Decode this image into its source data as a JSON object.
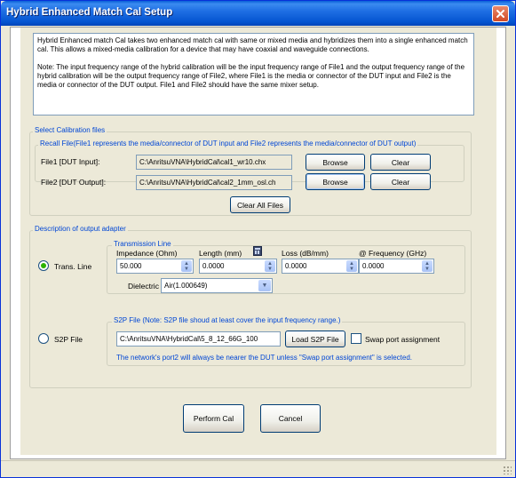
{
  "window": {
    "title": "Hybrid Enhanced Match Cal Setup"
  },
  "description": {
    "para1": "Hybrid Enhanced match Cal takes two enhanced match cal with same or mixed media and hybridizes them into a single enhanced match cal.  This allows a mixed-media calibration for a device that may have coaxial and waveguide connections.",
    "para2": "Note: The input frequency range of the hybrid calibration will be the input frequency range of File1 and the output frequency range of the hybrid calibration will be the output frequency range of File2, where File1 is the media or connector of the DUT input and File2 is the media or connector of the DUT output. File1 and File2 should have the same mixer setup."
  },
  "calfiles": {
    "group_label": "Select Calibration files",
    "recall_label": "Recall File(File1 represents the media/connector of DUT input and File2 represents the media/connector of DUT output)",
    "file1_label": "File1 [DUT Input]:",
    "file1_value": "C:\\AnritsuVNA\\HybridCal\\cal1_wr10.chx",
    "file2_label": "File2 [DUT Output]:",
    "file2_value": "C:\\AnritsuVNA\\HybridCal\\cal2_1mm_osl.ch",
    "browse_label": "Browse",
    "clear_label": "Clear",
    "clear_all_label": "Clear All Files"
  },
  "adapter": {
    "group_label": "Description of output adapter",
    "trans_line_radio": "Trans. Line",
    "trans_line_group": "Transmission Line",
    "impedance_label": "Impedance (Ohm)",
    "impedance_value": "50.000",
    "length_label": "Length (mm)",
    "length_value": "0.0000",
    "loss_label": "Loss (dB/mm)",
    "loss_value": "0.0000",
    "freq_label": "@ Frequency (GHz)",
    "freq_value": "0.0000",
    "dielectric_label": "Dielectric",
    "dielectric_value": "Air(1.000649)",
    "s2p_radio": "S2P File",
    "s2p_group": "S2P File (Note: S2P file shoud at least cover the input frequency range.)",
    "s2p_path": "C:\\AnritsuVNA\\HybridCal\\5_8_12_66G_100",
    "load_s2p_label": "Load S2P File",
    "swap_label": "Swap port assignment",
    "s2p_note": "The network's port2 will always be nearer the DUT unless \"Swap port assignment\" is selected."
  },
  "actions": {
    "perform_label": "Perform Cal",
    "cancel_label": "Cancel"
  },
  "colors": {
    "title_bar": "#0454d0",
    "group_text": "#0046d5",
    "close_button": "#d24a25",
    "radio_selected": "#2cb200"
  }
}
